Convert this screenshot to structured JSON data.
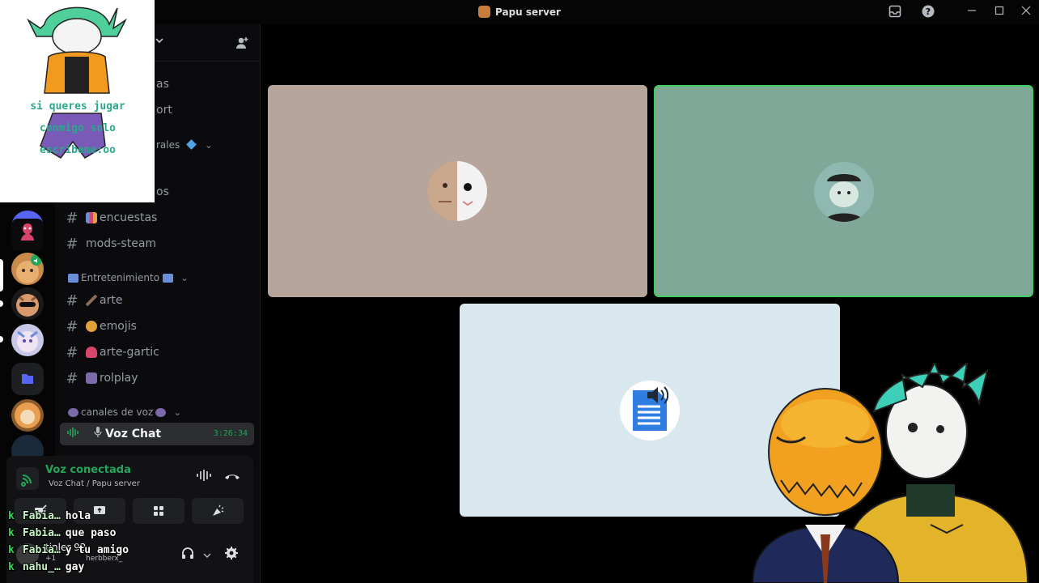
{
  "window": {
    "title": "Papu server"
  },
  "sidebar": {
    "partial_items": [
      "as",
      "ort",
      "rales",
      "os"
    ],
    "channels_top": [
      {
        "name": "encuestas",
        "emoji_color": "#6b8fd6"
      },
      {
        "name": "mods-steam",
        "emoji_color": ""
      }
    ],
    "category_entretenimiento": "Entretenimiento",
    "channels_entretenimiento": [
      {
        "name": "arte",
        "emoji_color": "#8a6a5a"
      },
      {
        "name": "emojis",
        "emoji_color": "#e0a23a"
      },
      {
        "name": "arte-gartic",
        "emoji_color": "#d8456a"
      },
      {
        "name": "rolplay",
        "emoji_color": "#7d6aa8"
      }
    ],
    "category_voz": "canales de voz",
    "voice_channel": {
      "name": "Voz Chat",
      "time": "3:26:34"
    }
  },
  "voice_panel": {
    "status": "Voz conectada",
    "location": "Voz Chat / Papu server"
  },
  "user_panel": {
    "username": "tinler 92",
    "extra": "+1",
    "sub_user": "herbberx_"
  },
  "stream_chat": [
    {
      "user": "Fabia…",
      "message": "hola"
    },
    {
      "user": "Fabia…",
      "message": "que paso"
    },
    {
      "user": "Fabia…",
      "message": "y tu amigo"
    },
    {
      "user": "nahu_…",
      "message": "gay"
    }
  ],
  "sticker": {
    "text_lines": [
      "si queres jugar",
      "conmigo solo",
      "escribeme:oo"
    ]
  },
  "tiles": [
    {
      "bg": "#b7a59b",
      "active": false
    },
    {
      "bg": "#7fa898",
      "active": true
    },
    {
      "bg": "#d8e8ee",
      "active": false
    }
  ],
  "colors": {
    "accent_green": "#23a55a",
    "speaking_border": "#3ecf5a",
    "bg": "#000000"
  },
  "icons": {
    "titlebar": [
      "inbox-icon",
      "help-icon",
      "minimize-icon",
      "maximize-icon",
      "close-icon"
    ],
    "voice_buttons": [
      "camera-off-icon",
      "screen-share-icon",
      "activity-icon",
      "soundboard-icon"
    ]
  }
}
